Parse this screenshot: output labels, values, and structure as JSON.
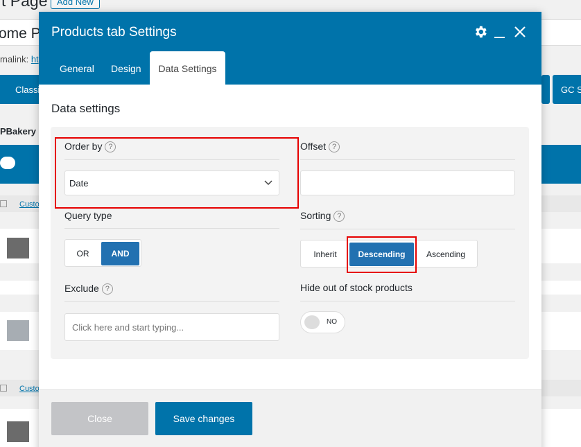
{
  "background": {
    "page_title": "t Page",
    "add_new": "Add New",
    "post_title": "ome P",
    "permalink_label": "malink:",
    "permalink_link": "ht",
    "classic_button": "Classi",
    "gc_button": "GC S",
    "wpbakery_label": "PBakery F",
    "custom_link": "Custo"
  },
  "modal": {
    "title": "Products tab Settings",
    "tabs": [
      {
        "label": "General",
        "active": false
      },
      {
        "label": "Design",
        "active": false
      },
      {
        "label": "Data Settings",
        "active": true
      }
    ],
    "section_title": "Data settings",
    "order_by": {
      "label": "Order by",
      "help": "?",
      "value": "Date"
    },
    "offset": {
      "label": "Offset",
      "help": "?",
      "value": ""
    },
    "query_type": {
      "label": "Query type",
      "options": [
        "OR",
        "AND"
      ],
      "selected": "AND"
    },
    "sorting": {
      "label": "Sorting",
      "help": "?",
      "options": [
        "Inherit",
        "Descending",
        "Ascending"
      ],
      "selected": "Descending"
    },
    "exclude": {
      "label": "Exclude",
      "help": "?",
      "placeholder": "Click here and start typing..."
    },
    "hide_out_of_stock": {
      "label": "Hide out of stock products",
      "toggle_text": "NO"
    },
    "footer": {
      "close_label": "Close",
      "save_label": "Save changes"
    },
    "colors": {
      "header": "#0073aa",
      "selected": "#2271b1",
      "highlight": "#e60000"
    }
  }
}
